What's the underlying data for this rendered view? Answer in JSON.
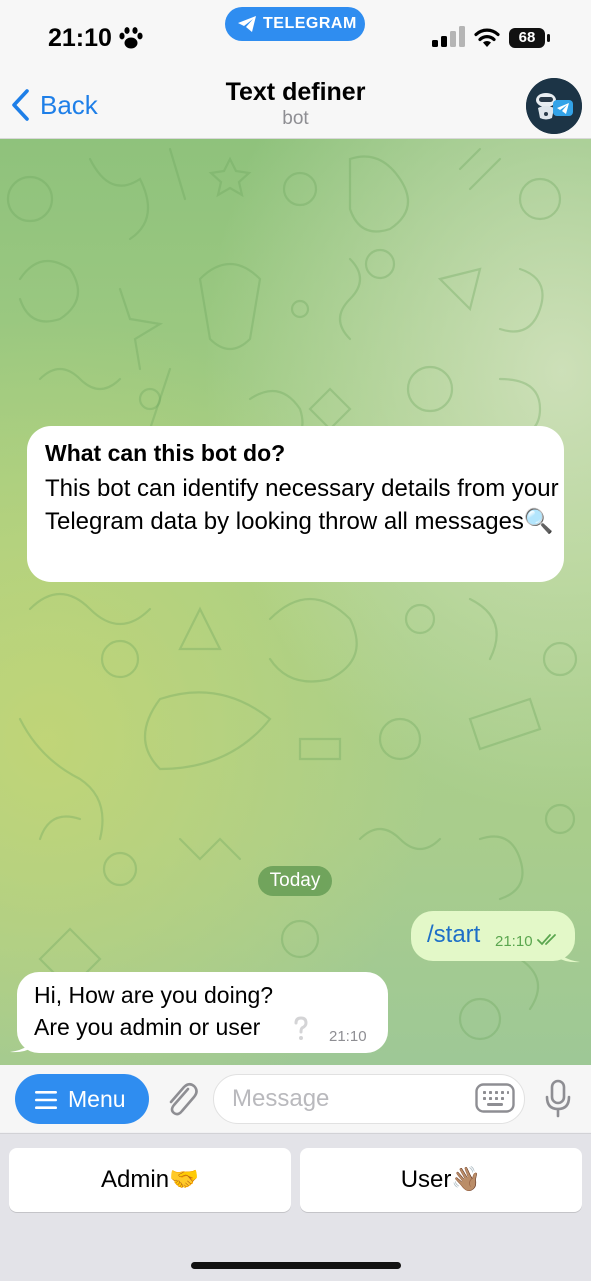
{
  "status_bar": {
    "time": "21:10",
    "pill_label": "TELEGRAM",
    "battery": "68"
  },
  "header": {
    "back_label": "Back",
    "title": "Text definer",
    "subtitle": "bot"
  },
  "chat": {
    "info": {
      "title": "What can this bot do?",
      "body": "This bot can identify necessary details from your Telegram data by looking throw all messages🔍"
    },
    "date_separator": "Today",
    "messages": [
      {
        "direction": "outgoing",
        "text": "/start",
        "time": "21:10"
      },
      {
        "direction": "incoming",
        "line1": "Hi, How are you doing?",
        "line2": "Are you admin or user",
        "time": "21:10"
      }
    ]
  },
  "composer": {
    "menu_label": "Menu",
    "placeholder": "Message"
  },
  "reply_keyboard": {
    "buttons": [
      "Admin🤝",
      "User👋🏽"
    ]
  },
  "colors": {
    "accent": "#2f8df0",
    "outgoing_bubble": "#e3f8c8",
    "link_text": "#1d6fc7"
  }
}
